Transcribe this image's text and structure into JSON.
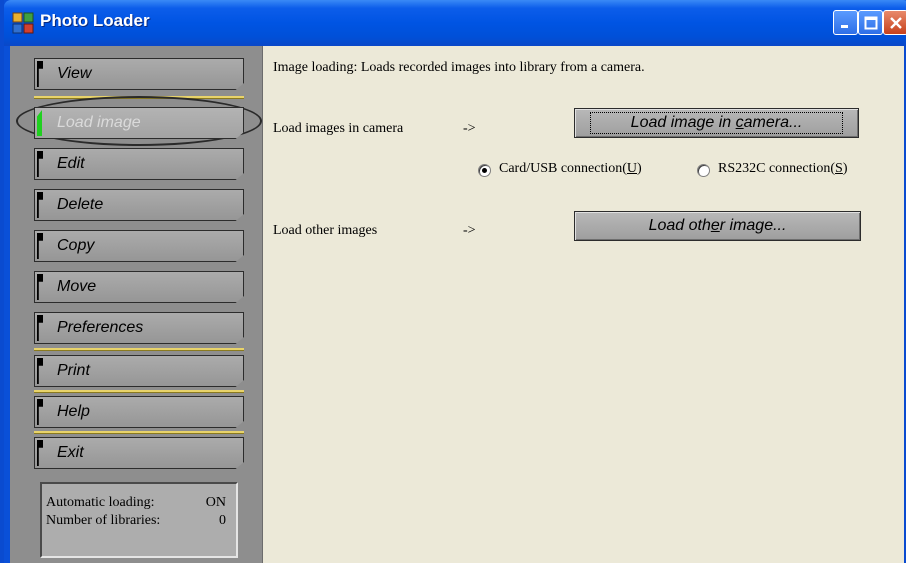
{
  "window": {
    "title": "Photo Loader"
  },
  "sidebar": {
    "items": [
      {
        "label": "View"
      },
      {
        "label": "Load image"
      },
      {
        "label": "Edit"
      },
      {
        "label": "Delete"
      },
      {
        "label": "Copy"
      },
      {
        "label": "Move"
      },
      {
        "label": "Preferences"
      },
      {
        "label": "Print"
      },
      {
        "label": "Help"
      },
      {
        "label": "Exit"
      }
    ],
    "active_item": "Load image",
    "status": {
      "auto_loading_label": "Automatic loading:",
      "auto_loading_value": "ON",
      "libraries_label": "Number of libraries:",
      "libraries_value": "0"
    }
  },
  "main": {
    "description": "Image loading: Loads recorded images into library from a camera.",
    "camera_label": "Load images in camera",
    "camera_arrow": "->",
    "camera_button_pre": "Load image in ",
    "camera_button_u": "c",
    "camera_button_post": "amera...",
    "radio_usb_pre": "Card/USB connection(",
    "radio_usb_u": "U",
    "radio_usb_post": ")",
    "radio_rs_pre": "RS232C connection(",
    "radio_rs_u": "S",
    "radio_rs_post": ")",
    "selected_connection": "usb",
    "other_label": "Load other images",
    "other_arrow": "->",
    "other_button_pre": "Load oth",
    "other_button_u": "e",
    "other_button_post": "r image..."
  },
  "colors": {
    "titlebar": "#0054E3",
    "sidebar_bg": "#8E8E8E",
    "active_indicator": "#20D020",
    "separator": "#E8D36A",
    "content_bg": "#ECE9D8"
  }
}
